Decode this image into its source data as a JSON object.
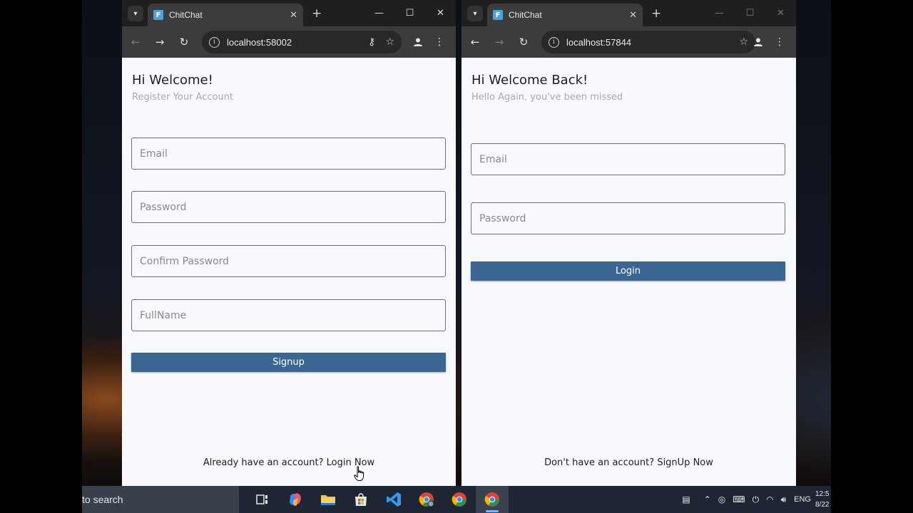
{
  "windows": {
    "left": {
      "tab_title": "ChitChat",
      "url": "localhost:58002",
      "page": {
        "greeting": "Hi Welcome!",
        "subtitle": "Register Your Account",
        "fields": {
          "email_placeholder": "Email",
          "password_placeholder": "Password",
          "confirm_password_placeholder": "Confirm Password",
          "fullname_placeholder": "FullName"
        },
        "submit_label": "Signup",
        "footer_prompt": "Already have an account?",
        "footer_link": "Login Now"
      }
    },
    "right": {
      "tab_title": "ChitChat",
      "url": "localhost:57844",
      "page": {
        "greeting": "Hi Welcome Back!",
        "subtitle": "Hello Again, you've been missed",
        "fields": {
          "email_placeholder": "Email",
          "password_placeholder": "Password"
        },
        "submit_label": "Login",
        "footer_prompt": "Don't have an account?",
        "footer_link": "SignUp Now"
      }
    }
  },
  "taskbar": {
    "search_text": "to search",
    "apps": [
      "task-view",
      "copilot",
      "file-explorer",
      "microsoft-store",
      "vs-code",
      "chrome-profile",
      "chrome",
      "chrome-active"
    ],
    "language": "ENG",
    "time": "12:5",
    "date": "8/22"
  },
  "colors": {
    "primary_button": "#3b6593",
    "browser_frame": "#3c3c3c",
    "page_background": "#f8f9fd"
  }
}
